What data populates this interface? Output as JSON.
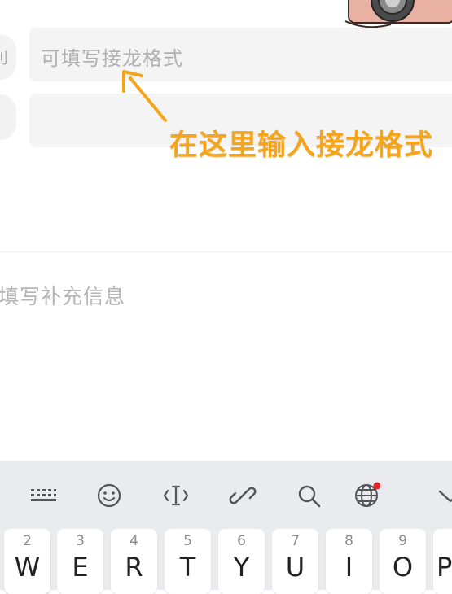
{
  "form": {
    "field1_placeholder": "可填写接龙格式",
    "field2_placeholder": "",
    "row_icon_glyph": "刂",
    "extra_info_placeholder": "填写补充信息"
  },
  "annotation": {
    "text": "在这里输入接龙格式",
    "color": "#f4a51c"
  },
  "keyboard": {
    "toolbar_icons": [
      "keyboard-grid-icon",
      "emoji-icon",
      "text-cursor-icon",
      "link-icon",
      "search-icon",
      "globe-icon",
      "chevron-down-icon"
    ],
    "keys": [
      {
        "num": "",
        "letter": ""
      },
      {
        "num": "2",
        "letter": "W"
      },
      {
        "num": "3",
        "letter": "E"
      },
      {
        "num": "4",
        "letter": "R"
      },
      {
        "num": "5",
        "letter": "T"
      },
      {
        "num": "6",
        "letter": "Y"
      },
      {
        "num": "7",
        "letter": "U"
      },
      {
        "num": "8",
        "letter": "I"
      },
      {
        "num": "9",
        "letter": "O"
      },
      {
        "num": "",
        "letter": "P"
      }
    ],
    "notification_dot_color": "#e02424"
  }
}
